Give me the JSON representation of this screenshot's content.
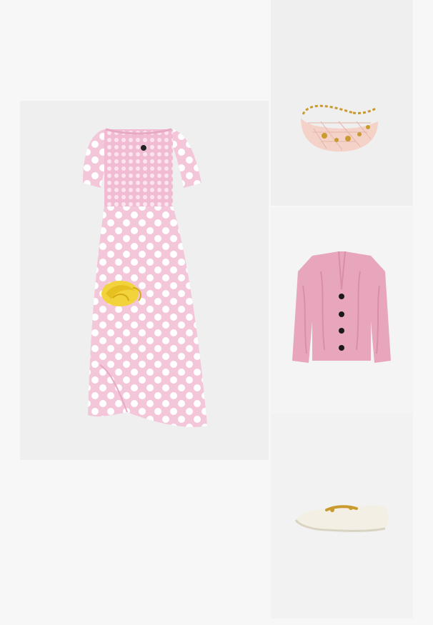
{
  "outfit": {
    "items": [
      {
        "id": "dress",
        "alt": "Pink polka dot smocked midi dress with yellow rose"
      },
      {
        "id": "bag",
        "alt": "Blush quilted shoulder bag with gold charm chain"
      },
      {
        "id": "cardigan",
        "alt": "Pink cable knit cardigan with black buttons"
      },
      {
        "id": "loafer",
        "alt": "Cream loafer with gold chain detail"
      }
    ]
  },
  "colors": {
    "page_bg": "#f7f7f7",
    "card_bg": "#efefef",
    "dress_pink": "#f3c6da",
    "dot_white": "#ffffff",
    "rose_yellow": "#f2d33c",
    "bag_blush": "#f4d2c8",
    "chain_gold": "#c99a2e",
    "cardigan_pink": "#e8a6bd",
    "button_black": "#1a1a1a",
    "loafer_cream": "#f3efe4"
  }
}
